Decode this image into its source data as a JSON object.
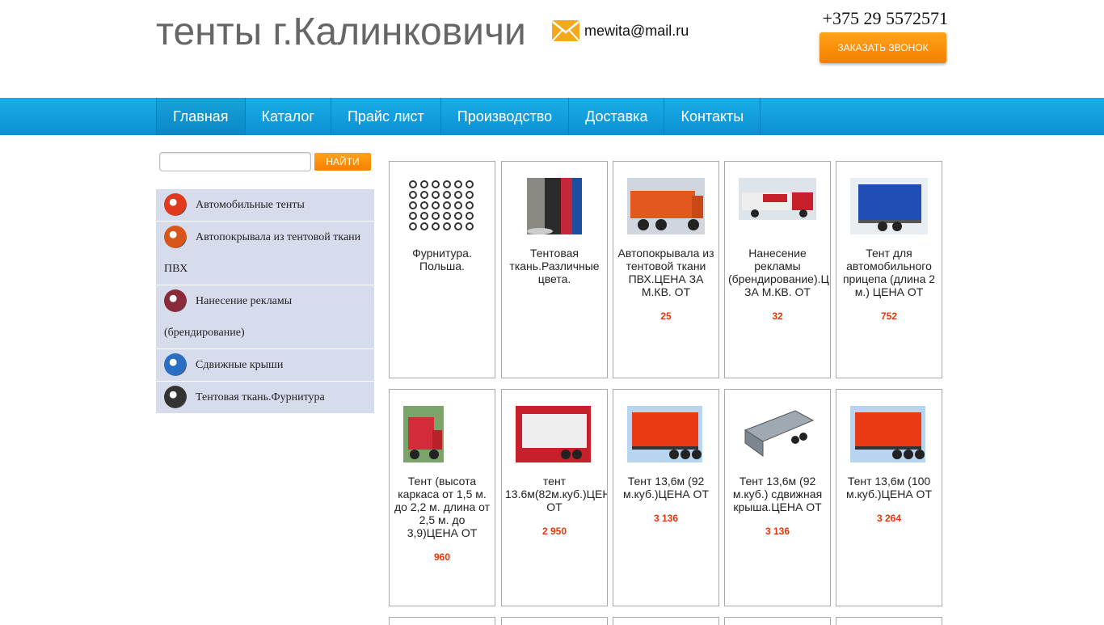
{
  "header": {
    "title": "тенты г.Калинковичи",
    "email": "mewita@mail.ru",
    "phone": "+375 29 5572571",
    "call_button": "ЗАКАЗАТЬ ЗВОНОК"
  },
  "nav": [
    "Главная",
    "Каталог",
    "Прайс лист",
    "Производство",
    "Доставка",
    "Контакты"
  ],
  "search": {
    "button": "НАЙТИ",
    "value": ""
  },
  "sidebar": [
    {
      "label": "Автомобильные тенты",
      "icon": "red-truck-icon",
      "color": "#e03a1e"
    },
    {
      "label": "Автопокрывала из тентовой ткани ПВХ",
      "icon": "orange-truck-icon",
      "color": "#d9561a"
    },
    {
      "label": "Нанесение рекламы (брендирование)",
      "icon": "branded-truck-icon",
      "color": "#8a2a3a"
    },
    {
      "label": "Сдвижные крыши",
      "icon": "sliding-roof-icon",
      "color": "#2a6fc4"
    },
    {
      "label": "Тентовая ткань.Фурнитура",
      "icon": "fabric-roll-icon",
      "color": "#333333"
    }
  ],
  "products": [
    {
      "title": "Фурнитура. Польша.",
      "price": "",
      "image": "fittings-image"
    },
    {
      "title": "Тентовая ткань.Различные цвета.",
      "price": "",
      "image": "fabric-rolls-image"
    },
    {
      "title": "Автопокрывала из тентовой ткани ПВХ.ЦЕНА ЗА М.КВ. ОТ",
      "price": "25",
      "image": "orange-dump-truck-image"
    },
    {
      "title": "Нанесение рекламы (брендирование).ЦЕНА ЗА М.КВ. ОТ",
      "price": "32",
      "image": "branded-truck-image"
    },
    {
      "title": "Тент для автомобильного прицепа (длина 2 м.) ЦЕНА ОТ",
      "price": "752",
      "image": "blue-trailer-image"
    },
    {
      "title": "Тент (высота каркаса от 1,5 м. до 2,2 м. длина от 2,5 м. до 3,9)ЦЕНА ОТ",
      "price": "960",
      "image": "red-van-image"
    },
    {
      "title": "тент 13.6м(82м.куб.)ЦЕНА ОТ",
      "price": "2 950",
      "image": "white-semitrailer-image"
    },
    {
      "title": "Тент 13,6м (92 м.куб.)ЦЕНА ОТ",
      "price": "3 136",
      "image": "red-semitrailer-image"
    },
    {
      "title": "Тент 13,6м (92 м.куб.) сдвижная крыша.ЦЕНА ОТ",
      "price": "3 136",
      "image": "sliding-frame-image"
    },
    {
      "title": "Тент 13,6м (100 м.куб.)ЦЕНА ОТ",
      "price": "3 264",
      "image": "red-semitrailer-image"
    }
  ]
}
